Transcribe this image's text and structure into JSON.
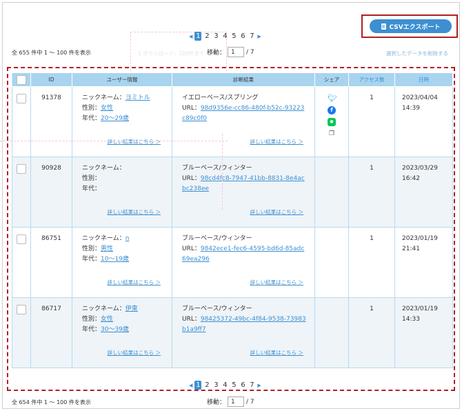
{
  "export": {
    "label": "CSVエクスポート",
    "icon": "document-icon"
  },
  "pagination": {
    "prev": "◀",
    "next": "▶",
    "pages": [
      "1",
      "2",
      "3",
      "4",
      "5",
      "6",
      "7"
    ],
    "active": "1"
  },
  "top": {
    "count": "全 655 件中 1 〜 100 件を表示",
    "move_label": "移動：",
    "page_value": "1",
    "page_total": "/ 7"
  },
  "bottom": {
    "count": "全 654 件中 1 〜 100 件を表示",
    "move_label": "移動：",
    "page_value": "1",
    "page_total": "/ 7"
  },
  "delete_label": "選択したデータを削除する",
  "ghost_label": "1 ダウンロード：100件まで",
  "table": {
    "headers": {
      "id": "ID",
      "user": "ユーザー情報",
      "diagnosis": "診断結果",
      "share": "シェア",
      "access": "アクセス数",
      "date": "日時"
    },
    "more_label": "詳しい結果はこちら ＞",
    "nickname_label": "ニックネーム：",
    "gender_label": "性別：",
    "age_label": "年代：",
    "url_label": "URL：",
    "rows": [
      {
        "id": "91378",
        "nickname": "ヨミトル",
        "gender": "女性",
        "age": "20〜29歳",
        "diagnosis": "イエローベース/スプリング",
        "url": "98d9356e-cc86-480f-b52c-93223c89c0f0",
        "access": "1",
        "date": "2023/04/04 14:39"
      },
      {
        "id": "90928",
        "nickname": "",
        "gender": "",
        "age": "",
        "diagnosis": "ブルーベース/ウィンター",
        "url": "98cd4fc8-7947-41bb-8831-8e4acbc238ee",
        "access": "1",
        "date": "2023/03/29 16:42"
      },
      {
        "id": "86751",
        "nickname": "n",
        "gender": "男性",
        "age": "10〜19歳",
        "diagnosis": "ブルーベース/ウィンター",
        "url": "9842ece1-fec6-4595-bd6d-85adc69ea296",
        "access": "1",
        "date": "2023/01/19 21:41"
      },
      {
        "id": "86717",
        "nickname": "伊東",
        "gender": "女性",
        "age": "30〜39歳",
        "diagnosis": "ブルーベース/ウィンター",
        "url": "98425372-49bc-4f84-9538-73983b1a9ff7",
        "access": "1",
        "date": "2023/01/19 14:33"
      }
    ]
  },
  "share_icons": [
    "twitter-icon",
    "facebook-icon",
    "line-icon",
    "copy-icon"
  ],
  "colors": {
    "accent": "#3d8fd1",
    "highlight": "#b01e23",
    "header_bg": "#a8d4ef"
  }
}
